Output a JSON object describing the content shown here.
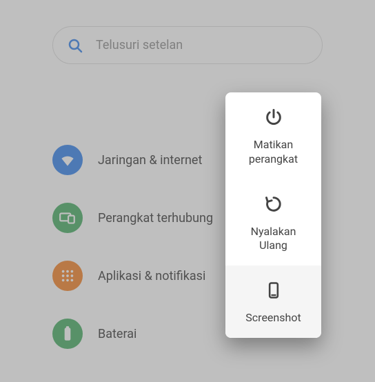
{
  "search": {
    "placeholder": "Telusuri setelan"
  },
  "settings": {
    "items": [
      {
        "label": "Jaringan & internet"
      },
      {
        "label": "Perangkat terhubung"
      },
      {
        "label": "Aplikasi & notifikasi"
      },
      {
        "label": "Baterai"
      }
    ]
  },
  "power_menu": {
    "items": [
      {
        "label": "Matikan\nperangkat"
      },
      {
        "label": "Nyalakan\nUlang"
      },
      {
        "label": "Screenshot"
      }
    ]
  }
}
